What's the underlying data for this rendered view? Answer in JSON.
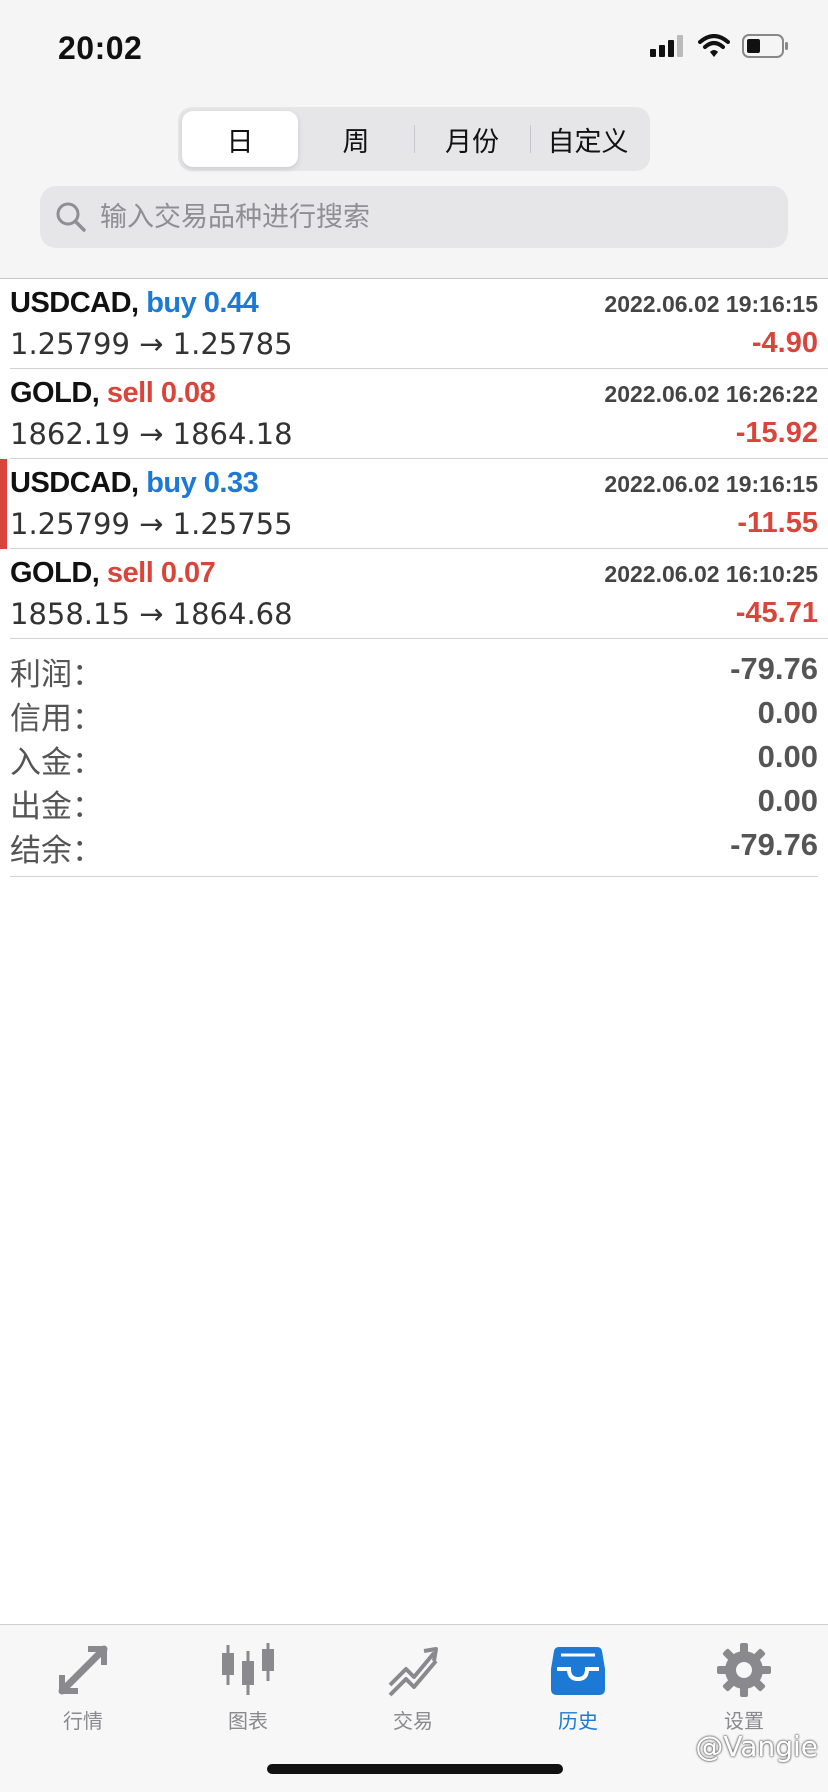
{
  "status_bar": {
    "time": "20:02"
  },
  "segments": [
    {
      "label": "日",
      "active": true
    },
    {
      "label": "周",
      "active": false
    },
    {
      "label": "月份",
      "active": false
    },
    {
      "label": "自定义",
      "active": false
    }
  ],
  "search": {
    "placeholder": "输入交易品种进行搜索"
  },
  "trades": [
    {
      "symbol": "USDCAD,",
      "side": "buy 0.44",
      "type": "buy",
      "time": "2022.06.02 19:16:15",
      "prices": "1.25799 → 1.25785",
      "profit": "-4.90"
    },
    {
      "symbol": "GOLD,",
      "side": "sell 0.08",
      "type": "sell",
      "time": "2022.06.02 16:26:22",
      "prices": "1862.19 → 1864.18",
      "profit": "-15.92"
    },
    {
      "symbol": "USDCAD,",
      "side": "buy 0.33",
      "type": "buy",
      "time": "2022.06.02 19:16:15",
      "prices": "1.25799 → 1.25755",
      "profit": "-11.55"
    },
    {
      "symbol": "GOLD,",
      "side": "sell 0.07",
      "type": "sell",
      "time": "2022.06.02 16:10:25",
      "prices": "1858.15 → 1864.68",
      "profit": "-45.71"
    }
  ],
  "summary": [
    {
      "label": "利润：",
      "value": "-79.76"
    },
    {
      "label": "信用：",
      "value": "0.00"
    },
    {
      "label": "入金：",
      "value": "0.00"
    },
    {
      "label": "出金：",
      "value": "0.00"
    },
    {
      "label": "结余：",
      "value": "-79.76"
    }
  ],
  "tabs": [
    {
      "label": "行情",
      "icon": "quotes-icon",
      "active": false
    },
    {
      "label": "图表",
      "icon": "chart-icon",
      "active": false
    },
    {
      "label": "交易",
      "icon": "trade-icon",
      "active": false
    },
    {
      "label": "历史",
      "icon": "history-icon",
      "active": true
    },
    {
      "label": "设置",
      "icon": "settings-icon",
      "active": false
    }
  ],
  "watermark": "@Vangie",
  "colors": {
    "buy": "#1c79d6",
    "sell": "#d9453a",
    "active_tab": "#1c79d6",
    "inactive_tab": "#8a8a8e"
  }
}
